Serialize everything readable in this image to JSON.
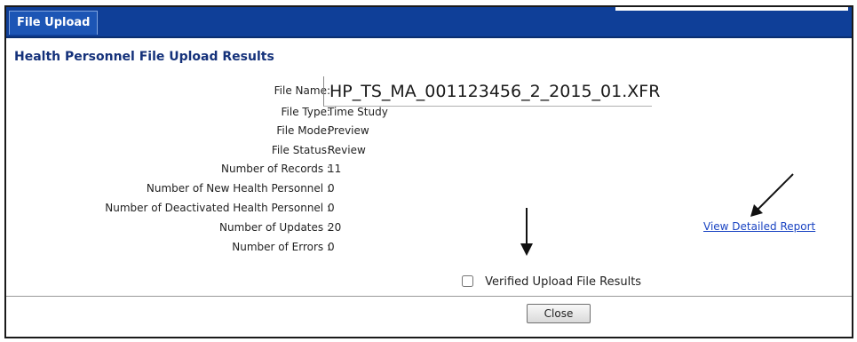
{
  "header": {
    "tab_label": "File Upload"
  },
  "page": {
    "title": "Health Personnel File Upload Results"
  },
  "details": [
    {
      "label": "File Name:",
      "value": "HP_TS_MA_001123456_2_2015_01.XFR"
    },
    {
      "label": "File Type:",
      "value": "Time Study"
    },
    {
      "label": "File Mode:",
      "value": "Preview"
    },
    {
      "label": "File Status:",
      "value": "Review"
    },
    {
      "label": "Number of Records :",
      "value": "11"
    },
    {
      "label": "Number of New Health Personnel :",
      "value": "0"
    },
    {
      "label": "Number of Deactivated Health Personnel :",
      "value": "0"
    },
    {
      "label": "Number of Updates :",
      "value": "20"
    },
    {
      "label": "Number of Errors :",
      "value": "0"
    }
  ],
  "links": {
    "detailed_report": "View Detailed Report"
  },
  "verify": {
    "label": "Verified Upload File Results",
    "checked": false
  },
  "buttons": {
    "close": "Close"
  },
  "colors": {
    "header": "#0f3f98",
    "title": "#14317a",
    "link": "#1a44c2"
  }
}
